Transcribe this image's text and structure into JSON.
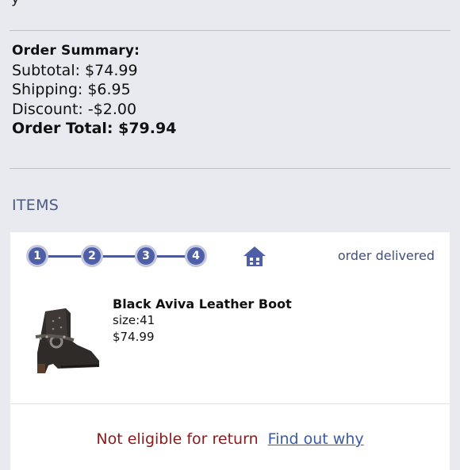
{
  "top_fragment": "y",
  "order_summary": {
    "title": "Order  Summary:",
    "subtotal": "Subtotal: $74.99",
    "shipping": "Shipping: $6.95",
    "discount": "Discount: -$2.00",
    "total": "Order Total: $79.94"
  },
  "items_heading": "ITEMS",
  "tracker": {
    "steps": [
      "1",
      "2",
      "3",
      "4"
    ],
    "status": "order delivered",
    "accent_color": "#4e5fa8"
  },
  "item": {
    "name": "Black Aviva Leather Boot",
    "size": "size:41",
    "price": "$74.99"
  },
  "return": {
    "status_text": "Not eligible for return",
    "link_text": "Find out why"
  }
}
